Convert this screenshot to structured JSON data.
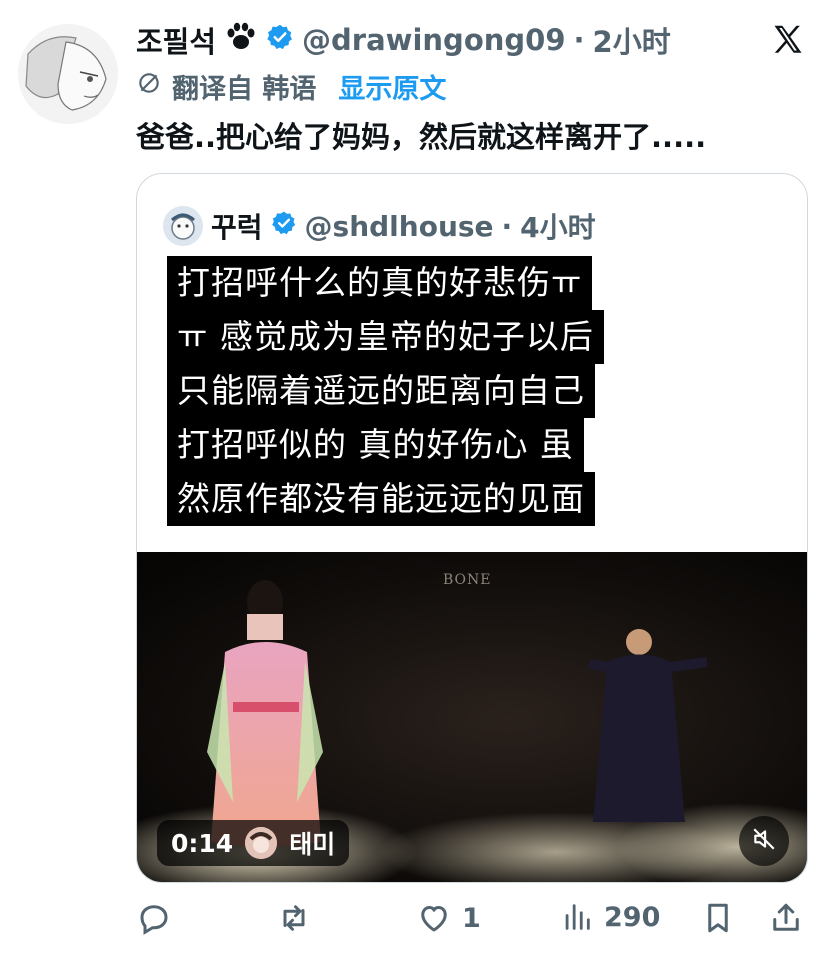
{
  "author": {
    "display_name": "조필석",
    "handle": "@drawingong09",
    "separator": "·",
    "time": "2小时"
  },
  "translation": {
    "label": "翻译自 韩语",
    "show_original": "显示原文"
  },
  "tweet_text": "爸爸..把心给了妈妈，然后就这样离开了.....",
  "quote": {
    "display_name": "꾸럭",
    "handle": "@shdlhouse",
    "separator": "·",
    "time": "4小时",
    "caption_lines": [
      "打招呼什么的真的好悲伤ㅠ",
      "ㅠ 感觉成为皇帝的妃子以后",
      "只能隔着遥远的距离向自己",
      "打招呼似的 真的好伤心 虽",
      "然原作都没有能远远的见面"
    ],
    "video": {
      "watermark": "BONE",
      "timestamp": "0:14",
      "uploader": "태미"
    }
  },
  "actions": {
    "reply_count": "",
    "retweet_count": "",
    "like_count": "1",
    "views_count": "290"
  },
  "colors": {
    "accent": "#1d9bf0",
    "secondary_text": "#536471",
    "verified": "#1d9bf0"
  },
  "icons": [
    "paw-icon",
    "verified-badge-icon",
    "x-logo-icon",
    "translate-icon",
    "mute-icon",
    "reply-icon",
    "retweet-icon",
    "like-icon",
    "views-icon",
    "bookmark-icon",
    "share-icon"
  ]
}
